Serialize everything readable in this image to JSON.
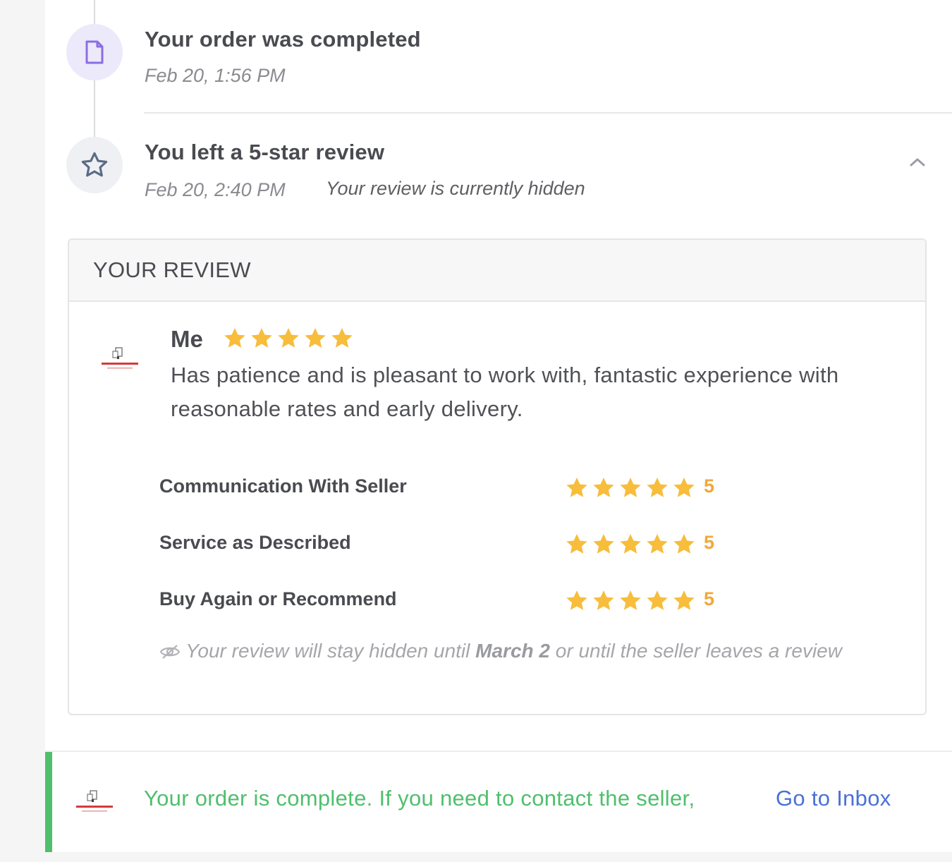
{
  "timeline": {
    "order_completed": {
      "icon": "document-icon",
      "title": "Your order was completed",
      "date": "Feb 20, 1:56 PM"
    },
    "review_left": {
      "icon": "star-outline-icon",
      "title": "You left a 5-star review",
      "date": "Feb 20, 2:40 PM",
      "status": "Your review is currently hidden"
    }
  },
  "review_card": {
    "header": "YOUR REVIEW",
    "reviewer": "Me",
    "overall_rating": 5,
    "text": "Has patience and is pleasant to work with, fantastic experience with reasonable rates and early delivery.",
    "ratings": [
      {
        "label": "Communication With Seller",
        "value": "5"
      },
      {
        "label": "Service as Described",
        "value": "5"
      },
      {
        "label": "Buy Again or Recommend",
        "value": "5"
      }
    ],
    "hidden_notice": {
      "prefix": "Your review will stay hidden until ",
      "date": "March 2",
      "suffix": " or until the seller leaves a review"
    }
  },
  "footer": {
    "message": "Your order is complete. If you need to contact the seller,",
    "link": "Go to Inbox"
  },
  "colors": {
    "star": "#f7bd3b",
    "rating_value": "#f0a93b",
    "success": "#4fbf6d",
    "link": "#4a71d6",
    "order_icon": "#8a6ee0"
  }
}
